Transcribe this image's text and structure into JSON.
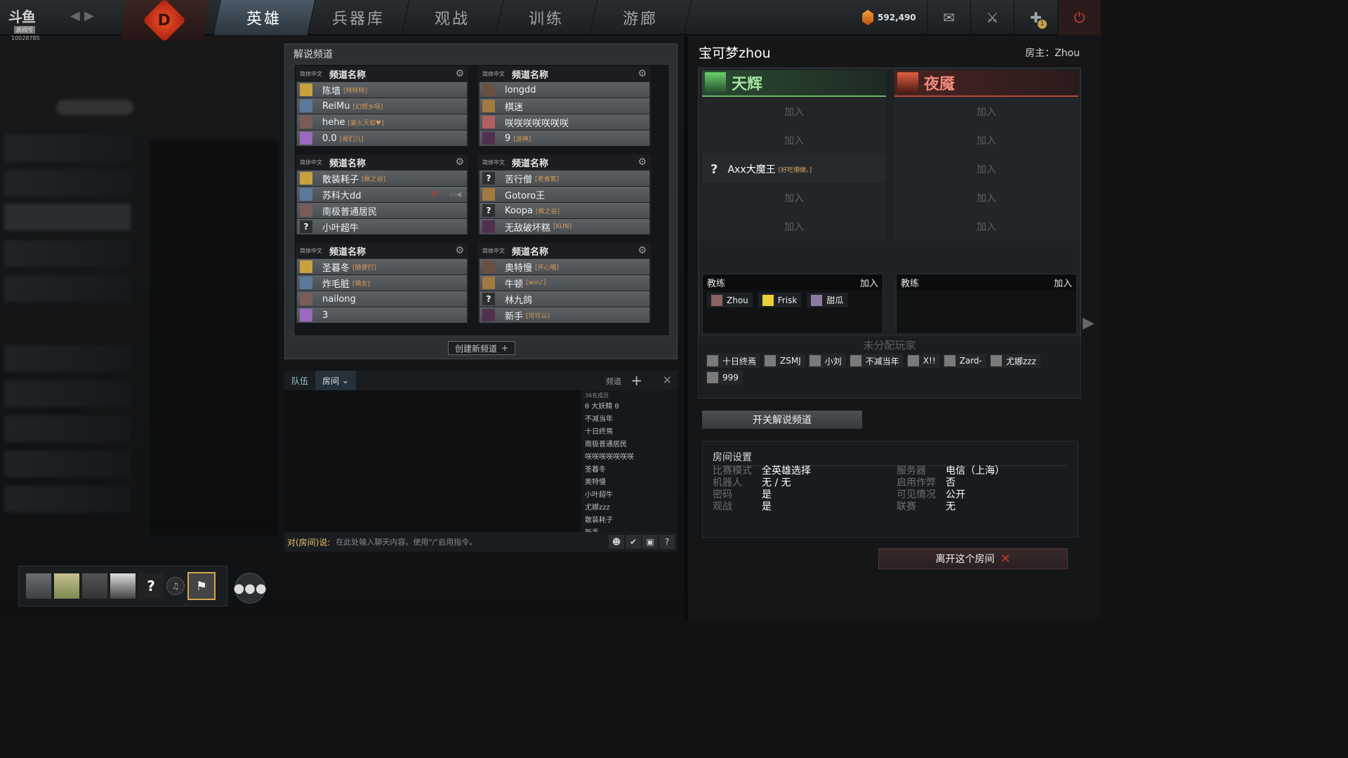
{
  "topbar": {
    "logo": "斗鱼",
    "logo_sub": "房间号",
    "uid": "10028785",
    "tabs": [
      {
        "label": "英雄",
        "active": true
      },
      {
        "label": "兵器库",
        "active": false
      },
      {
        "label": "观战",
        "active": false
      },
      {
        "label": "训练",
        "active": false
      },
      {
        "label": "游廊",
        "active": false
      }
    ],
    "shards": "592,490",
    "notif_count": "1"
  },
  "broadcast": {
    "title": "解说频道",
    "create_label": "创建新频道",
    "channels": [
      {
        "lang": "简体中文",
        "name": "频道名称",
        "members": [
          {
            "name": "陈墙",
            "tag": "[特特特]",
            "av": ""
          },
          {
            "name": "ReiMu",
            "tag": "[幻想乡呀]",
            "av": ""
          },
          {
            "name": "hehe",
            "tag": "[豪火灭却♥]",
            "av": ""
          },
          {
            "name": "0.0",
            "tag": "[哥们儿]",
            "av": ""
          }
        ]
      },
      {
        "lang": "简体中文",
        "name": "频道名称",
        "members": [
          {
            "name": "longdd",
            "tag": "",
            "av": ""
          },
          {
            "name": "棋迷",
            "tag": "",
            "av": ""
          },
          {
            "name": "咲咲咲咲咲咲咲",
            "tag": "",
            "av": ""
          },
          {
            "name": "9",
            "tag": "[游神]",
            "av": ""
          }
        ]
      },
      {
        "lang": "简体中文",
        "name": "频道名称",
        "members": [
          {
            "name": "散装耗子",
            "tag": "[枫之谷]",
            "av": ""
          },
          {
            "name": "苏科大dd",
            "tag": "",
            "av": ""
          },
          {
            "name": "南极普通居民",
            "tag": "",
            "av": ""
          },
          {
            "name": "小叶超牛",
            "tag": "",
            "av": "?"
          }
        ]
      },
      {
        "lang": "简体中文",
        "name": "频道名称",
        "members": [
          {
            "name": "苦行僧",
            "tag": "[老食客]",
            "av": "?"
          },
          {
            "name": "Gotoro王",
            "tag": "",
            "av": ""
          },
          {
            "name": "Koopa",
            "tag": "[枫之谷]",
            "av": "?"
          },
          {
            "name": "无敌破坏糕",
            "tag": "[KUN]",
            "av": ""
          }
        ]
      },
      {
        "lang": "简体中文",
        "name": "频道名称",
        "members": [
          {
            "name": "圣暮冬",
            "tag": "[随便打]",
            "av": ""
          },
          {
            "name": "炸毛脏",
            "tag": "[萌女]",
            "av": ""
          },
          {
            "name": "nailong",
            "tag": "",
            "av": ""
          },
          {
            "name": "3",
            "tag": "",
            "av": ""
          }
        ]
      },
      {
        "lang": "简体中文",
        "name": "频道名称",
        "members": [
          {
            "name": "奥特慢",
            "tag": "[开心喵]",
            "av": ""
          },
          {
            "name": "牛顿",
            "tag": "[win♪]",
            "av": ""
          },
          {
            "name": "林九鸽",
            "tag": "",
            "av": "?"
          },
          {
            "name": "新手",
            "tag": "[可可以]",
            "av": ""
          }
        ]
      }
    ]
  },
  "chat": {
    "tab_team": "队伍",
    "tab_room": "房间",
    "channel_btn": "频道",
    "member_count": "36名成员",
    "members": [
      "θ 大妖精 θ",
      "不减当年",
      "十日终焉",
      "南极普通居民",
      "咲咲咲咲咲咲咲",
      "圣暮冬",
      "奥特慢",
      "小叶超牛",
      "尤娜zzz",
      "散装耗子",
      "新手"
    ],
    "input_label": "对(房间)说:",
    "input_placeholder": "在此处输入聊天内容。使用\"/\"启用指令。"
  },
  "lobby": {
    "title": "宝可梦zhou",
    "host": "房主：Zhou",
    "radiant": {
      "name": "天辉",
      "slots": [
        {
          "type": "empty",
          "label": "加入"
        },
        {
          "type": "empty",
          "label": "加入"
        },
        {
          "type": "filled",
          "name": "Axx大魔王",
          "tag": "[好吃懒做。]"
        },
        {
          "type": "empty",
          "label": "加入"
        },
        {
          "type": "empty",
          "label": "加入"
        }
      ],
      "coach_label": "教练",
      "coach_join": "加入",
      "coaches": [
        {
          "name": "Zhou",
          "cls": ""
        },
        {
          "name": "Frisk",
          "cls": "y"
        },
        {
          "name": "甜瓜",
          "cls": "t"
        }
      ]
    },
    "dire": {
      "name": "夜魇",
      "slots": [
        {
          "type": "empty",
          "label": "加入"
        },
        {
          "type": "empty",
          "label": "加入"
        },
        {
          "type": "empty",
          "label": "加入"
        },
        {
          "type": "empty",
          "label": "加入"
        },
        {
          "type": "empty",
          "label": "加入"
        }
      ],
      "coach_label": "教练",
      "coach_join": "加入",
      "coaches": []
    },
    "unassigned_title": "未分配玩家",
    "unassigned": [
      "十日终焉",
      "ZSMJ",
      "小刘",
      "不减当年",
      "X!!",
      "Zard-",
      "尤娜zzz",
      "999"
    ],
    "toggle_bc": "开关解说频道",
    "settings_title": "房间设置",
    "settings": [
      {
        "k": "比赛模式",
        "v": "全英雄选择"
      },
      {
        "k": "机器人",
        "v": "无 / 无"
      },
      {
        "k": "密码",
        "v": "是"
      },
      {
        "k": "观战",
        "v": "是"
      },
      {
        "k": "服务器",
        "v": "电信（上海）"
      },
      {
        "k": "启用作弊",
        "v": "否"
      },
      {
        "k": "可见情况",
        "v": "公开"
      },
      {
        "k": "联赛",
        "v": "无"
      }
    ],
    "leave": "离开这个房间"
  },
  "party": {
    "coach_icon": "coach-icon"
  },
  "colors": {
    "radiant": "#9fe39a",
    "dire": "#f08a7a",
    "gold": "#e4c06a"
  }
}
